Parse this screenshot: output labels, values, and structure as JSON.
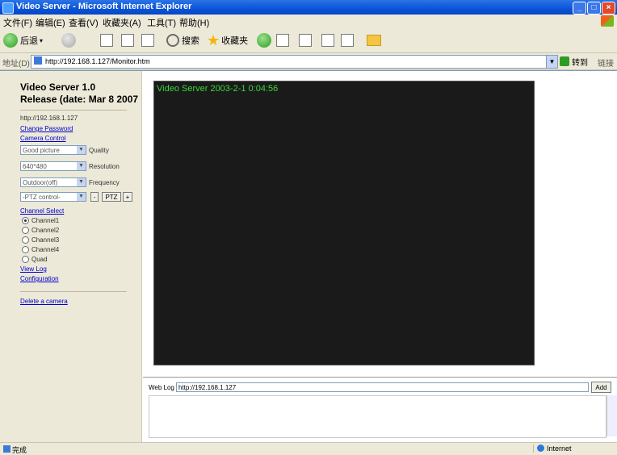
{
  "window": {
    "title": "Video Server - Microsoft Internet Explorer"
  },
  "menu": [
    "文件(F)",
    "编辑(E)",
    "查看(V)",
    "收藏夹(A)",
    "工具(T)",
    "帮助(H)"
  ],
  "toolbar": {
    "back_label": "后退",
    "search_label": "搜索",
    "favorites_label": "收藏夹"
  },
  "address": {
    "label": "地址(D)",
    "url": "http://192.168.1.127/Monitor.htm",
    "go_label": "转到",
    "links_label": "链接"
  },
  "left_panel": {
    "title": "Video Server 1.0",
    "release": "Release (date: Mar 8 2007",
    "server_ip": "http://192.168.1.127",
    "change_password": "Change Password",
    "camera_control": "Camera Control",
    "quality_value": "Good picture",
    "quality_label": "Quality",
    "resolution_value": "640*480",
    "resolution_label": "Resolution",
    "frequency_value": "Outdoor(off)",
    "frequency_label": "Frequency",
    "ptz_value": "-PTZ control-",
    "ptz_minus": "-",
    "ptz_btn": "PTZ",
    "ptz_plus": "+",
    "channel_select": "Channel Select",
    "channels": [
      "Channel1",
      "Channel2",
      "Channel3",
      "Channel4",
      "Quad"
    ],
    "view_log": "View Log",
    "configuration": "Configuration",
    "delete_camera": "Delete a camera"
  },
  "video": {
    "osd": "Video Server  2003-2-1 0:04:56"
  },
  "bottom": {
    "label": "Web Log",
    "value": "http://192.168.1.127",
    "button": "Add"
  },
  "status": {
    "text": "完成",
    "zone": "Internet"
  }
}
